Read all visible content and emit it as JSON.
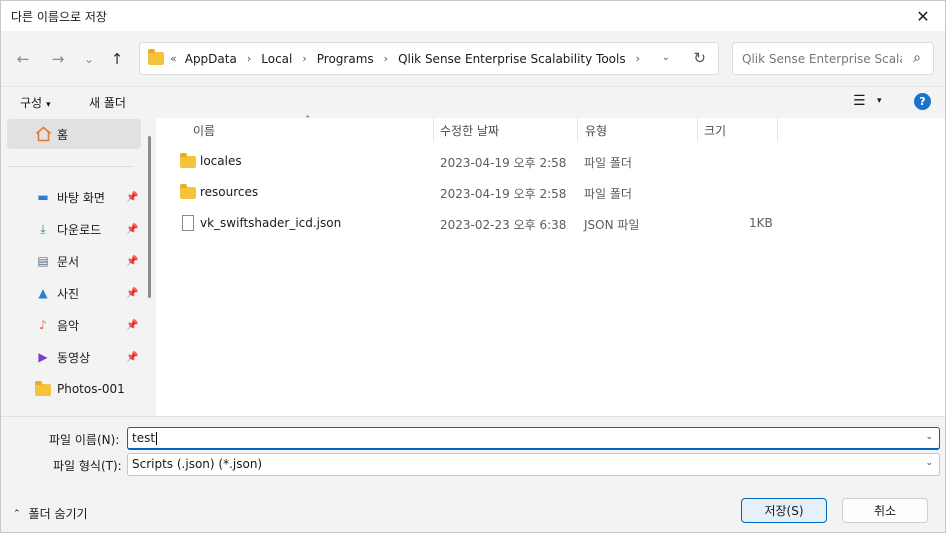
{
  "window": {
    "title": "다른 이름으로 저장",
    "close_glyph": "✕"
  },
  "nav": {
    "back_glyph": "←",
    "forward_glyph": "→",
    "recent_glyph": "⌄",
    "up_glyph": "↑",
    "more_glyph": "«",
    "breadcrumb": [
      "AppData",
      "Local",
      "Programs",
      "Qlik Sense Enterprise Scalability Tools"
    ],
    "separator_glyph": "›",
    "dropdown_glyph": "⌄",
    "refresh_glyph": "↻",
    "search_placeholder": "Qlik Sense Enterprise Scala...",
    "search_glyph": "⌕"
  },
  "toolbar": {
    "organize_label": "구성",
    "organize_caret": "▾",
    "new_folder_label": "새 폴더",
    "view_glyph": "☰",
    "view_caret": "▾",
    "help_glyph": "?"
  },
  "sidebar": {
    "home": {
      "label": "홈",
      "icon": "home-icon"
    },
    "pin_glyph": "📌",
    "items": [
      {
        "label": "바탕 화면",
        "icon": "desktop-icon",
        "glyph": "▬",
        "color": "#2b7fd6",
        "pinned": true
      },
      {
        "label": "다운로드",
        "icon": "download-icon",
        "glyph": "⤓",
        "color": "#1b9a54",
        "pinned": true
      },
      {
        "label": "문서",
        "icon": "document-icon",
        "glyph": "▤",
        "color": "#5a6b7f",
        "pinned": true
      },
      {
        "label": "사진",
        "icon": "pictures-icon",
        "glyph": "▲",
        "color": "#2b7fd6",
        "pinned": true
      },
      {
        "label": "음악",
        "icon": "music-icon",
        "glyph": "♪",
        "color": "#e06a3c",
        "pinned": true
      },
      {
        "label": "동영상",
        "icon": "videos-icon",
        "glyph": "▶",
        "color": "#7a3fc9",
        "pinned": true
      },
      {
        "label": "Photos-001",
        "icon": "folder-icon",
        "glyph": "",
        "color": "#f5c33b",
        "pinned": false
      }
    ]
  },
  "filelist": {
    "columns": [
      "이름",
      "수정한 날짜",
      "유형",
      "크기"
    ],
    "sort_glyph": "⌃",
    "rows": [
      {
        "name": "locales",
        "modified": "2023-04-19 오후 2:58",
        "type": "파일 폴더",
        "size": "",
        "kind": "folder"
      },
      {
        "name": "resources",
        "modified": "2023-04-19 오후 2:58",
        "type": "파일 폴더",
        "size": "",
        "kind": "folder"
      },
      {
        "name": "vk_swiftshader_icd.json",
        "modified": "2023-02-23 오후 6:38",
        "type": "JSON 파일",
        "size": "1KB",
        "kind": "file"
      }
    ]
  },
  "form": {
    "filename_label": "파일 이름(N):",
    "filename_value": "test",
    "filetype_label": "파일 형식(T):",
    "filetype_value": "Scripts (.json) (*.json)",
    "dropdown_glyph": "⌄"
  },
  "footer": {
    "hide_folders_label": "폴더 숨기기",
    "hide_folders_caret": "⌃",
    "save_label": "저장(S)",
    "cancel_label": "취소"
  }
}
